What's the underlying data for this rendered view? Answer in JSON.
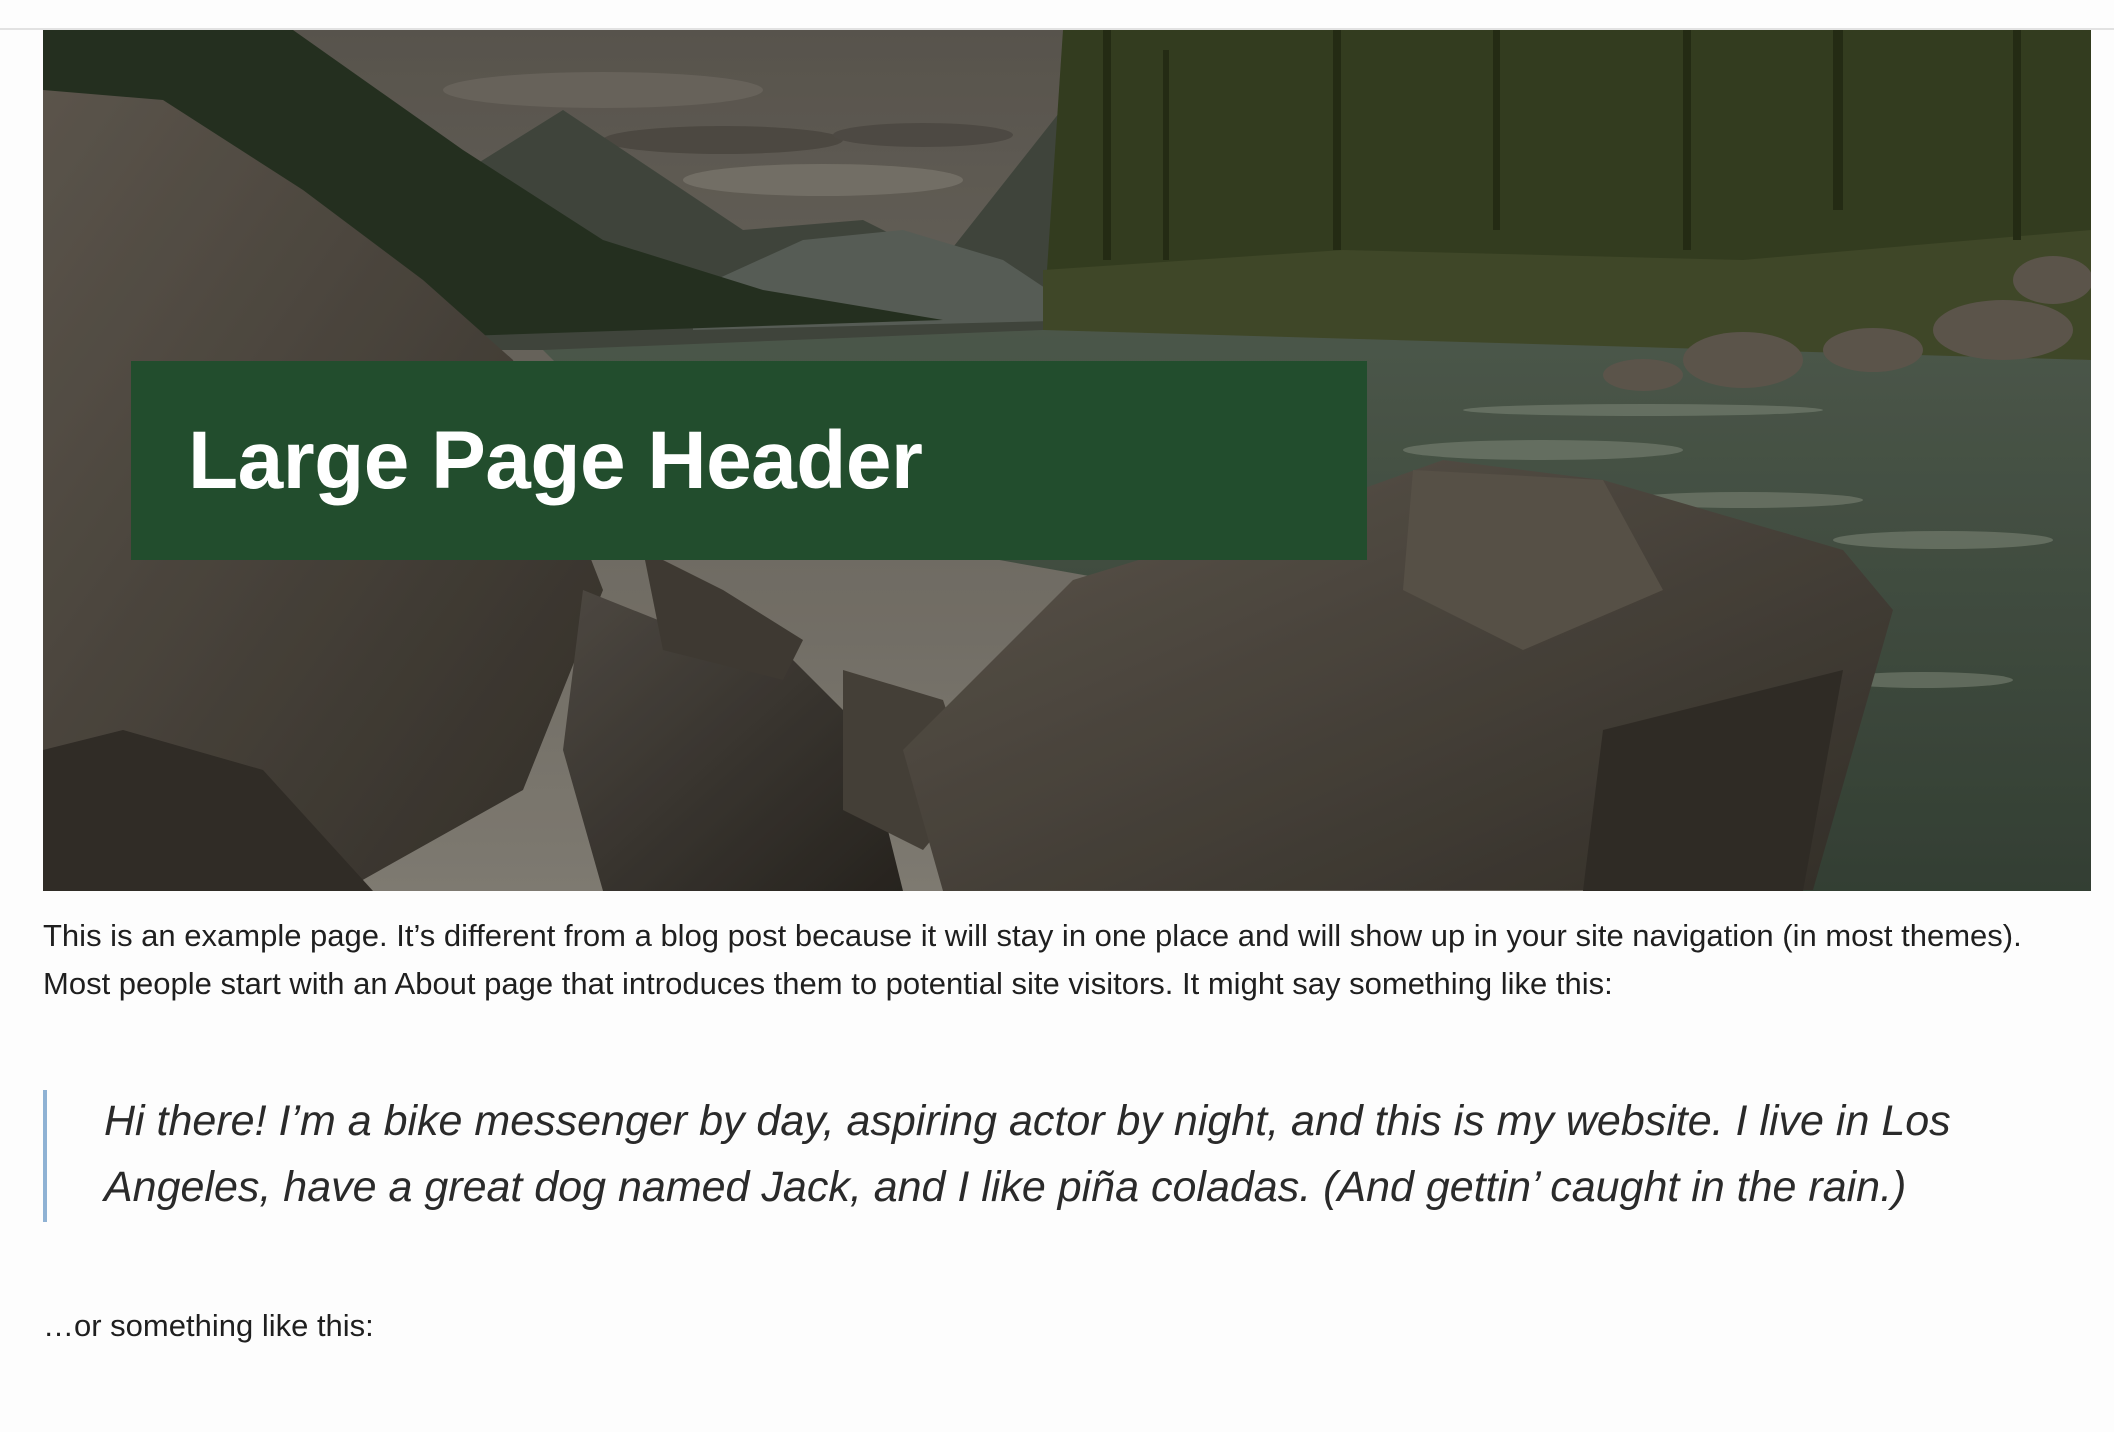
{
  "header": {
    "title": "Large Page Header"
  },
  "content": {
    "intro": "This is an example page. It’s different from a blog post because it will stay in one place and will show up in your site navigation (in most themes). Most people start with an About page that introduces them to potential site visitors. It might say something like this:",
    "quote": "Hi there! I’m a bike messenger by day, aspiring actor by night, and this is my website. I live in Los Angeles, have a great dog named Jack, and I like piña coladas. (And gettin’ caught in the rain.)",
    "outro": "…or something like this:"
  },
  "colors": {
    "header_box": "#224d2d",
    "quote_border": "#8fb2d4",
    "text": "#1f1f1f"
  }
}
